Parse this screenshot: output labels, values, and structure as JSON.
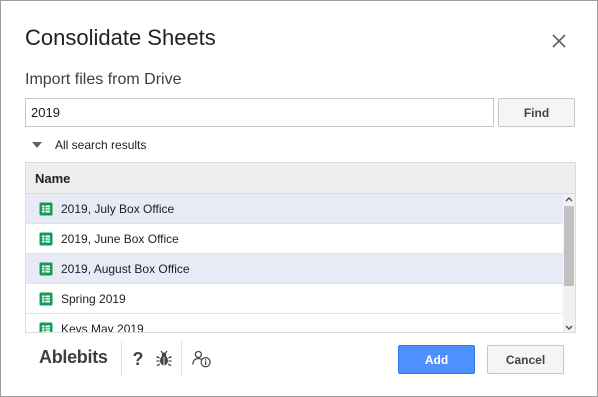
{
  "dialog": {
    "title": "Consolidate Sheets",
    "subtitle": "Import files from Drive"
  },
  "search": {
    "value": "2019",
    "find_label": "Find"
  },
  "results": {
    "toggle_label": "All search results",
    "column_header": "Name",
    "files": [
      {
        "name": "2019, July Box Office",
        "selected": true,
        "icon": "sheets-icon"
      },
      {
        "name": "2019, June Box Office",
        "selected": false,
        "icon": "sheets-icon"
      },
      {
        "name": "2019, August Box Office",
        "selected": true,
        "icon": "sheets-icon"
      },
      {
        "name": "Spring 2019",
        "selected": false,
        "icon": "sheets-icon"
      },
      {
        "name": "Keys May 2019",
        "selected": false,
        "icon": "sheets-icon"
      }
    ]
  },
  "footer": {
    "brand": "Ablebits",
    "help_glyph": "?",
    "add_label": "Add",
    "cancel_label": "Cancel"
  },
  "colors": {
    "accent": "#4d90fe",
    "sheets_green": "#0f9d58",
    "selected_row": "#e8eaf6"
  }
}
